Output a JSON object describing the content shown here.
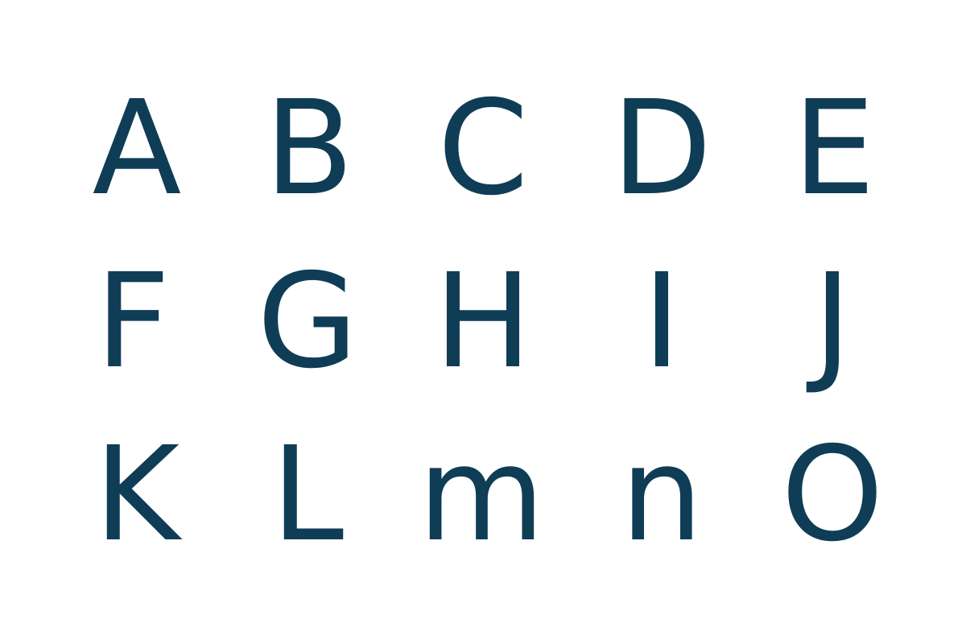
{
  "specimen": {
    "glyph_color": "#0f3d56",
    "background_color": "#ffffff",
    "rows": [
      [
        "A",
        "B",
        "C",
        "D",
        "E"
      ],
      [
        "F",
        "G",
        "H",
        "I",
        "J"
      ],
      [
        "K",
        "L",
        "m",
        "n",
        "O"
      ]
    ]
  }
}
